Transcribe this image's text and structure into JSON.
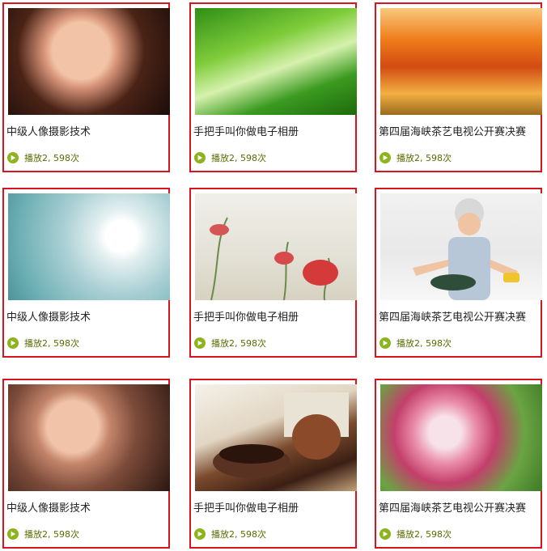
{
  "items": [
    {
      "title": "中级人像摄影技术",
      "plays": "播放2, 598次",
      "image": "portrait-girl-with-flowers"
    },
    {
      "title": "手把手叫你做电子相册",
      "plays": "播放2, 598次",
      "image": "green-bamboo-leaves"
    },
    {
      "title": "第四届海峡茶艺电视公开赛决赛",
      "plays": "播放2, 598次",
      "image": "autumn-orange-trees"
    },
    {
      "title": "中级人像摄影技术",
      "plays": "播放2, 598次",
      "image": "dandelion-seeds"
    },
    {
      "title": "手把手叫你做电子相册",
      "plays": "播放2, 598次",
      "image": "red-poppies"
    },
    {
      "title": "第四届海峡茶艺电视公开赛决赛",
      "plays": "播放2, 598次",
      "image": "elderly-woman-cooking"
    },
    {
      "title": "中级人像摄影技术",
      "plays": "播放2, 598次",
      "image": "portrait-young-woman"
    },
    {
      "title": "手把手叫你做电子相册",
      "plays": "播放2, 598次",
      "image": "tea-cup-and-teapot"
    },
    {
      "title": "第四届海峡茶艺电视公开赛决赛",
      "plays": "播放2, 598次",
      "image": "pink-bell-flowers"
    }
  ],
  "colors": {
    "border": "#d8141c",
    "play_icon": "#8db31d",
    "meta_text": "#5a6a00"
  }
}
